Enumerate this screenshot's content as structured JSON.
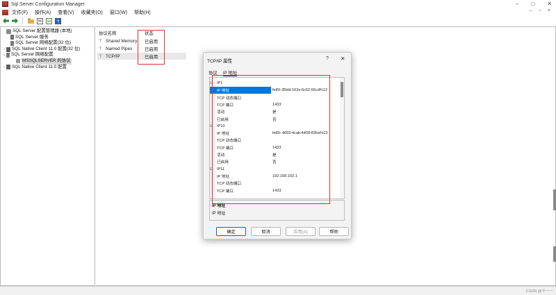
{
  "window": {
    "title": "Sql Server Configuration Manager",
    "controls": [
      "–",
      "□",
      "✕"
    ]
  },
  "menu": {
    "items": [
      "文件(F)",
      "操作(A)",
      "查看(V)",
      "收藏夹(O)",
      "窗口(W)",
      "帮助(H)"
    ],
    "mdi_controls": "– ▫ ×"
  },
  "toolbar": {
    "buttons": [
      "back-icon",
      "forward-icon",
      "up-folder-icon",
      "properties-icon",
      "export-icon",
      "help-icon"
    ]
  },
  "tree": {
    "items": [
      {
        "label": "SQL Server 配置管理器 (本地)",
        "level": 0,
        "twisty": ""
      },
      {
        "label": "SQL Server 服务",
        "level": 1,
        "twisty": ""
      },
      {
        "label": "SQL Server 网络配置(32 位)",
        "level": 1,
        "twisty": ""
      },
      {
        "label": "SQL Native Client 11.0 配置(32 位)",
        "level": 1,
        "twisty": "›"
      },
      {
        "label": "SQL Server 网络配置",
        "level": 1,
        "twisty": "⌄"
      },
      {
        "label": "MSSQLSERVER 的协议",
        "level": 2,
        "twisty": ""
      },
      {
        "label": "SQL Native Client 11.0 配置",
        "level": 1,
        "twisty": "›"
      }
    ]
  },
  "list": {
    "headers": {
      "name": "协议名称",
      "status": "状态"
    },
    "rows": [
      {
        "name": "Shared Memory",
        "status": "已启用"
      },
      {
        "name": "Named Pipes",
        "status": "已启用"
      },
      {
        "name": "TCP/IP",
        "status": "已启用"
      }
    ]
  },
  "dialog": {
    "title": "TCP/IP 属性",
    "help": "?",
    "close": "✕",
    "tabs": [
      "协议",
      "IP 地址"
    ],
    "rows": [
      {
        "type": "cat",
        "key": "IP1",
        "value": ""
      },
      {
        "type": "prop",
        "key": "IP 地址",
        "value": "fe80::85dd:162e:6c52:56cd%12",
        "highlight": true
      },
      {
        "type": "prop",
        "key": "TCP 动态端口",
        "value": ""
      },
      {
        "type": "prop",
        "key": "TCP 端口",
        "value": "1433"
      },
      {
        "type": "prop",
        "key": "活动",
        "value": "是"
      },
      {
        "type": "prop",
        "key": "已启用",
        "value": "否"
      },
      {
        "type": "cat",
        "key": "IP10",
        "value": ""
      },
      {
        "type": "prop",
        "key": "IP 地址",
        "value": "fe80::4655:4cab:4409:835a%13"
      },
      {
        "type": "prop",
        "key": "TCP 动态端口",
        "value": ""
      },
      {
        "type": "prop",
        "key": "TCP 端口",
        "value": "1433"
      },
      {
        "type": "prop",
        "key": "活动",
        "value": "是"
      },
      {
        "type": "prop",
        "key": "已启用",
        "value": "否"
      },
      {
        "type": "cat",
        "key": "IP11",
        "value": ""
      },
      {
        "type": "prop",
        "key": "IP 地址",
        "value": "192.168.192.1"
      },
      {
        "type": "prop",
        "key": "TCP 动态端口",
        "value": ""
      },
      {
        "type": "prop",
        "key": "TCP 端口",
        "value": "1433"
      }
    ],
    "description": {
      "title": "IP 地址",
      "text": "IP 地址"
    },
    "buttons": {
      "ok": "确定",
      "cancel": "取消",
      "apply": "应用(A)",
      "help": "帮助"
    }
  },
  "statusbar": {
    "watermark": "CSDN @十一一"
  },
  "colors": {
    "annotation": "#e03030",
    "selection": "#0078d7"
  }
}
